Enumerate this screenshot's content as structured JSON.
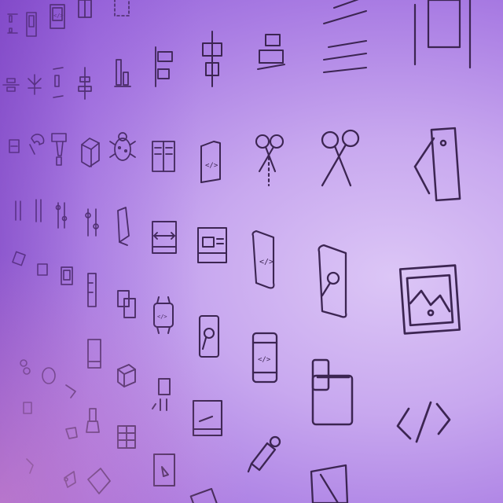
{
  "scene": {
    "description_free": true,
    "colors": {
      "background_light": "#dcc6f6",
      "background_mid": "#c8a8ef",
      "background_dark": "#8f5bd6",
      "line_color": "#3c2552",
      "edge_glow": "#e196cd"
    }
  },
  "icons": [
    {
      "name": "align-top-icon"
    },
    {
      "name": "code-window-icon"
    },
    {
      "name": "picture-frame-icon"
    },
    {
      "name": "selection-box-icon"
    },
    {
      "name": "align-horizontal-lines-icon"
    },
    {
      "name": "align-right-icon"
    },
    {
      "name": "align-left-bars-icon"
    },
    {
      "name": "align-bottom-icon"
    },
    {
      "name": "align-vertical-center-icon"
    },
    {
      "name": "align-right-boxes-icon"
    },
    {
      "name": "align-center-lines-icon"
    },
    {
      "name": "magnet-icon"
    },
    {
      "name": "paint-roller-icon"
    },
    {
      "name": "cube-icon"
    },
    {
      "name": "bug-icon"
    },
    {
      "name": "book-icon"
    },
    {
      "name": "code-book-icon"
    },
    {
      "name": "scissors-cut-icon"
    },
    {
      "name": "scissors-icon"
    },
    {
      "name": "swatch-icon"
    },
    {
      "name": "sliders-icon"
    },
    {
      "name": "prism-icon"
    },
    {
      "name": "resize-window-icon"
    },
    {
      "name": "layout-window-icon"
    },
    {
      "name": "code-scroll-icon"
    },
    {
      "name": "draw-scroll-icon"
    },
    {
      "name": "image-icon"
    },
    {
      "name": "code-watch-icon"
    },
    {
      "name": "touch-phone-icon"
    },
    {
      "name": "code-phone-icon"
    },
    {
      "name": "devices-icon"
    },
    {
      "name": "code-brackets-icon"
    },
    {
      "name": "grid-table-icon"
    },
    {
      "name": "plug-icon"
    },
    {
      "name": "laptop-screen-icon"
    },
    {
      "name": "eyedropper-icon"
    },
    {
      "name": "paper-cutter-icon"
    }
  ]
}
